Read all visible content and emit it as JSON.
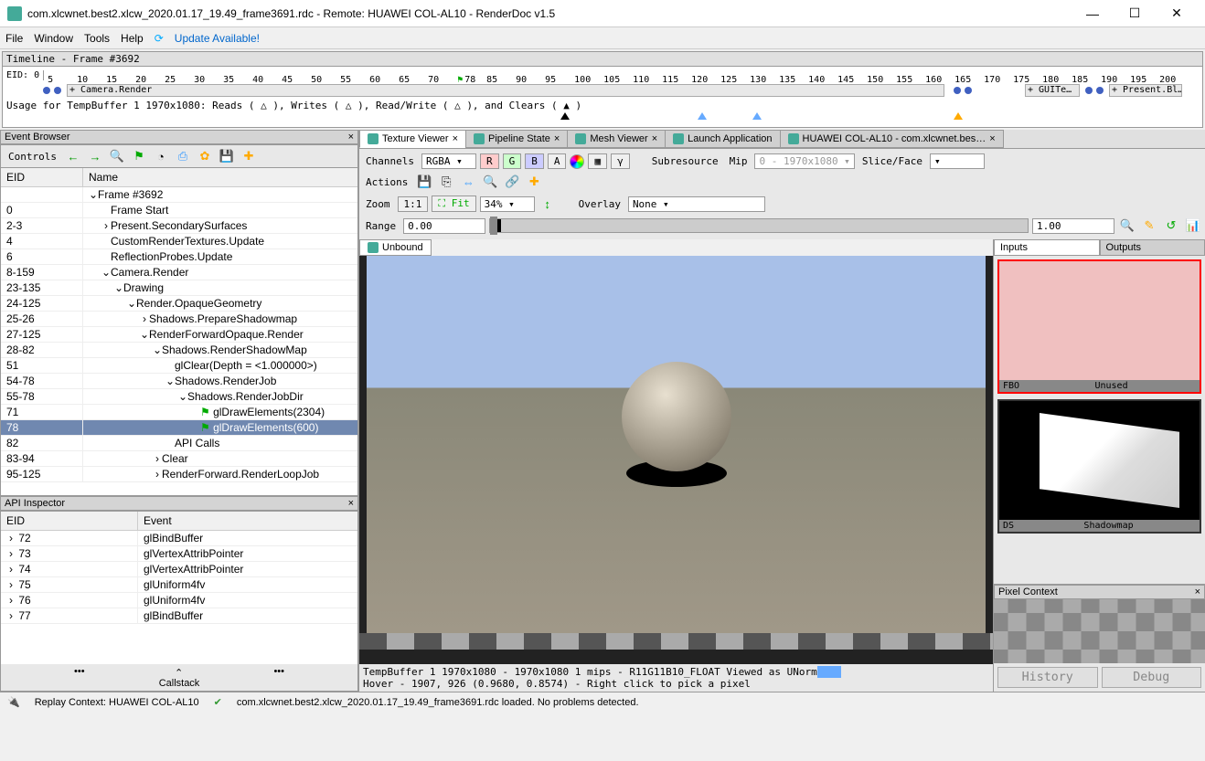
{
  "window": {
    "title": "com.xlcwnet.best2.xlcw_2020.01.17_19.49_frame3691.rdc - Remote: HUAWEI COL-AL10 - RenderDoc v1.5"
  },
  "menu": {
    "file": "File",
    "window": "Window",
    "tools": "Tools",
    "help": "Help",
    "update": "Update Available!"
  },
  "timeline": {
    "header": "Timeline - Frame #3692",
    "eid_label": "EID:",
    "eid_value": "0",
    "ticks": [
      "5",
      "10",
      "15",
      "20",
      "25",
      "30",
      "35",
      "40",
      "45",
      "50",
      "55",
      "60",
      "65",
      "70",
      "78",
      "85",
      "90",
      "95",
      "100",
      "105",
      "110",
      "115",
      "120",
      "125",
      "130",
      "135",
      "140",
      "145",
      "150",
      "155",
      "160",
      "165",
      "170",
      "175",
      "180",
      "185",
      "190",
      "195",
      "200"
    ],
    "seg1": "+ Camera.Render",
    "seg2": "+ GUITe…",
    "seg3": "+ Present.Bl…",
    "usage": "Usage for TempBuffer 1 1970x1080: Reads ( △ ), Writes ( △ ), Read/Write ( △ ), and Clears ( ▲ )"
  },
  "eventBrowser": {
    "title": "Event Browser",
    "controls": "Controls",
    "col_eid": "EID",
    "col_name": "Name",
    "rows": [
      {
        "eid": "",
        "name": "Frame #3692",
        "ind": 0,
        "tw": "v"
      },
      {
        "eid": "0",
        "name": "Frame Start",
        "ind": 1,
        "tw": ""
      },
      {
        "eid": "2-3",
        "name": "Present.SecondarySurfaces",
        "ind": 1,
        "tw": ">"
      },
      {
        "eid": "4",
        "name": "CustomRenderTextures.Update",
        "ind": 1,
        "tw": ""
      },
      {
        "eid": "6",
        "name": "ReflectionProbes.Update",
        "ind": 1,
        "tw": ""
      },
      {
        "eid": "8-159",
        "name": "Camera.Render",
        "ind": 1,
        "tw": "v"
      },
      {
        "eid": "23-135",
        "name": "Drawing",
        "ind": 2,
        "tw": "v"
      },
      {
        "eid": "24-125",
        "name": "Render.OpaqueGeometry",
        "ind": 3,
        "tw": "v"
      },
      {
        "eid": "25-26",
        "name": "Shadows.PrepareShadowmap",
        "ind": 4,
        "tw": ">"
      },
      {
        "eid": "27-125",
        "name": "RenderForwardOpaque.Render",
        "ind": 4,
        "tw": "v"
      },
      {
        "eid": "28-82",
        "name": "Shadows.RenderShadowMap",
        "ind": 5,
        "tw": "v"
      },
      {
        "eid": "51",
        "name": "glClear(Depth = <1.000000>)",
        "ind": 6,
        "tw": ""
      },
      {
        "eid": "54-78",
        "name": "Shadows.RenderJob",
        "ind": 6,
        "tw": "v"
      },
      {
        "eid": "55-78",
        "name": "Shadows.RenderJobDir",
        "ind": 7,
        "tw": "v"
      },
      {
        "eid": "71",
        "name": "glDrawElements(2304)",
        "ind": 8,
        "tw": "",
        "flag": true
      },
      {
        "eid": "78",
        "name": "glDrawElements(600)",
        "ind": 8,
        "tw": "",
        "flag": true,
        "sel": true
      },
      {
        "eid": "82",
        "name": "API Calls",
        "ind": 6,
        "tw": ""
      },
      {
        "eid": "83-94",
        "name": "Clear",
        "ind": 5,
        "tw": ">"
      },
      {
        "eid": "95-125",
        "name": "RenderForward.RenderLoopJob",
        "ind": 5,
        "tw": ">"
      }
    ]
  },
  "apiInspector": {
    "title": "API Inspector",
    "col_eid": "EID",
    "col_event": "Event",
    "rows": [
      {
        "eid": "72",
        "ev": "glBindBuffer"
      },
      {
        "eid": "73",
        "ev": "glVertexAttribPointer"
      },
      {
        "eid": "74",
        "ev": "glVertexAttribPointer"
      },
      {
        "eid": "75",
        "ev": "glUniform4fv"
      },
      {
        "eid": "76",
        "ev": "glUniform4fv"
      },
      {
        "eid": "77",
        "ev": "glBindBuffer"
      }
    ],
    "callstack": "Callstack"
  },
  "tabs": {
    "t1": "Texture Viewer",
    "t2": "Pipeline State",
    "t3": "Mesh Viewer",
    "t4": "Launch Application",
    "t5": "HUAWEI COL-AL10 - com.xlcwnet.bes…"
  },
  "tv": {
    "channels_lbl": "Channels",
    "channels_val": "RGBA",
    "r": "R",
    "g": "G",
    "b": "B",
    "a": "A",
    "checker": "▦",
    "gamma": "γ",
    "subres_lbl": "Subresource",
    "mip_lbl": "Mip",
    "mip_val": "0 - 1970x1080",
    "slice_lbl": "Slice/Face",
    "actions_lbl": "Actions",
    "zoom_lbl": "Zoom",
    "zoom_11": "1:1",
    "fit": "Fit",
    "zoom_pct": "34%",
    "overlay_lbl": "Overlay",
    "overlay_val": "None",
    "range_lbl": "Range",
    "range_lo": "0.00",
    "range_hi": "1.00",
    "unbound": "Unbound",
    "status1": "TempBuffer 1 1970x1080 - 1970x1080 1 mips - R11G11B10_FLOAT Viewed as UNorm",
    "status2a": "Hover - 1907,  926 (0.9680, 0.8574) - Right click to pick a pixel"
  },
  "side": {
    "inputs": "Inputs",
    "outputs": "Outputs",
    "t1_a": "FBO",
    "t1_b": "Unused",
    "t2_a": "DS",
    "t2_b": "Shadowmap",
    "pxctx": "Pixel Context",
    "history": "History",
    "debug": "Debug"
  },
  "status": {
    "replay": "Replay Context: HUAWEI COL-AL10",
    "loaded": "com.xlcwnet.best2.xlcw_2020.01.17_19.49_frame3691.rdc loaded. No problems detected."
  }
}
